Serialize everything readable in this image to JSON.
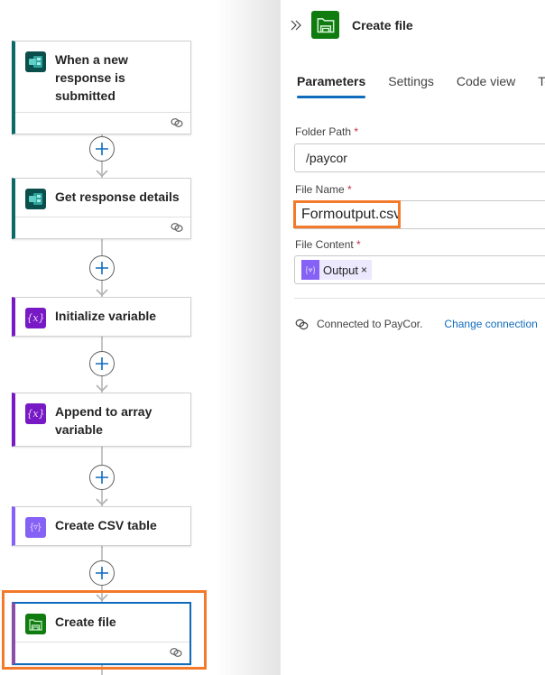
{
  "colors": {
    "forms_teal": "#0b6a66",
    "variable_purple": "#7719c4",
    "data_ops_purple": "#8661f5",
    "file_green": "#107c10",
    "selected_blue": "#0f6cbd",
    "highlight_orange": "#f37a2b",
    "required_red": "#c4314b"
  },
  "flow": {
    "steps": [
      {
        "title": "When a new response is submitted",
        "icon": "microsoft-forms-icon",
        "has_connection": true
      },
      {
        "title": "Get response details",
        "icon": "microsoft-forms-icon",
        "has_connection": true
      },
      {
        "title": "Initialize variable",
        "icon": "variable-icon",
        "has_connection": false
      },
      {
        "title": "Append to array variable",
        "icon": "variable-icon",
        "has_connection": false
      },
      {
        "title": "Create CSV table",
        "icon": "data-operation-icon",
        "has_connection": false
      },
      {
        "title": "Create file",
        "icon": "file-system-icon",
        "has_connection": true,
        "selected": true
      }
    ],
    "insert_step_icon": "plus-icon"
  },
  "panel": {
    "title": "Create file",
    "collapse_icon": "double-chevron-right-icon",
    "tabs": [
      {
        "label": "Parameters",
        "active": true
      },
      {
        "label": "Settings",
        "active": false
      },
      {
        "label": "Code view",
        "active": false
      },
      {
        "label": "Testing",
        "active": false
      }
    ],
    "fields": {
      "folder_path": {
        "label": "Folder Path",
        "required_mark": "*",
        "value": "/paycor"
      },
      "file_name": {
        "label": "File Name",
        "required_mark": "*",
        "value": "Formoutput.csv"
      },
      "file_content": {
        "label": "File Content",
        "required_mark": "*",
        "token": "Output",
        "token_remove": "×"
      }
    },
    "connection": {
      "status": "Connected to PayCor.",
      "change_label": "Change connection"
    }
  }
}
